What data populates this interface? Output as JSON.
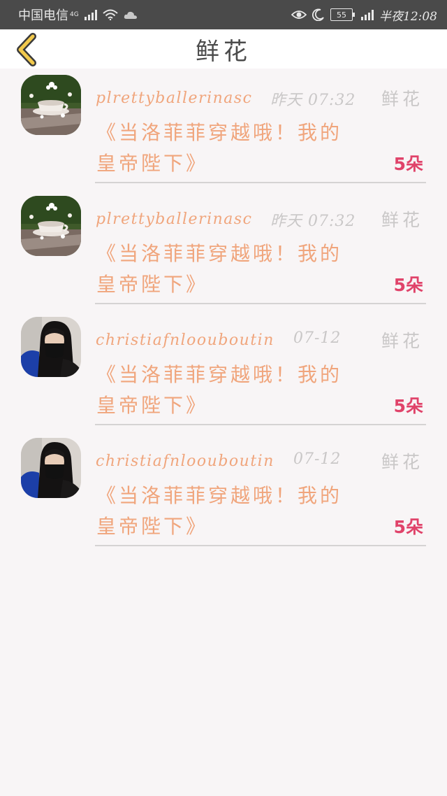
{
  "status_bar": {
    "carrier": "中国电信",
    "network": "4G",
    "battery": "55",
    "time": "半夜12:08",
    "icons": [
      "signal-icon",
      "wifi-icon",
      "cloud-icon",
      "eye-icon",
      "moon-icon",
      "battery-icon"
    ]
  },
  "nav": {
    "title": "鲜花",
    "back_icon": "chevron-left-icon",
    "accent_color": "#f2c94c"
  },
  "items": [
    {
      "username": "plrettyballerinasc",
      "time": "昨天 07:32",
      "category": "鲜花",
      "message": "《当洛菲菲穿越哦！我的皇帝陛下》",
      "count": "5朵",
      "avatar": "teacup-avatar"
    },
    {
      "username": "plrettyballerinasc",
      "time": "昨天 07:32",
      "category": "鲜花",
      "message": "《当洛菲菲穿越哦！我的皇帝陛下》",
      "count": "5朵",
      "avatar": "teacup-avatar"
    },
    {
      "username": "christiafnloouboutin",
      "time": "07-12",
      "category": "鲜花",
      "message": "《当洛菲菲穿越哦！我的皇帝陛下》",
      "count": "5朵",
      "avatar": "person-avatar"
    },
    {
      "username": "christiafnloouboutin",
      "time": "07-12",
      "category": "鲜花",
      "message": "《当洛菲菲穿越哦！我的皇帝陛下》",
      "count": "5朵",
      "avatar": "person-avatar"
    }
  ],
  "colors": {
    "username": "#f0a57c",
    "message": "#f0a57c",
    "meta": "#c9c7c7",
    "count": "#e0436a",
    "background": "#f8f5f6"
  }
}
